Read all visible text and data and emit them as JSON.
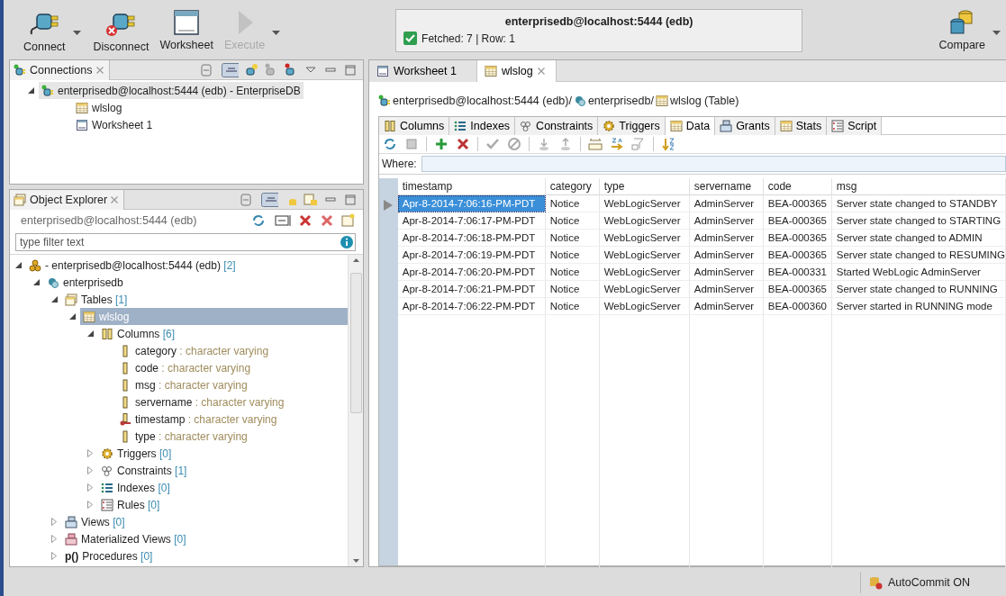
{
  "toolbar": {
    "buttons": [
      {
        "label": "Connect",
        "disabled": false,
        "dropdown": true
      },
      {
        "label": "Disconnect",
        "disabled": false,
        "dropdown": false
      },
      {
        "label": "Worksheet",
        "disabled": false,
        "dropdown": false
      },
      {
        "label": "Execute",
        "disabled": true,
        "dropdown": true
      }
    ],
    "status": {
      "title": "enterprisedb@localhost:5444 (edb)",
      "message": "Fetched: 7 | Row: 1",
      "ok": true
    },
    "compare": {
      "label": "Compare",
      "dropdown": true
    }
  },
  "connections": {
    "title": "Connections",
    "tree": [
      {
        "label": "enterprisedb@localhost:5444 (edb) - EnterpriseDB",
        "kind": "connection",
        "expanded": true,
        "selected": true,
        "children": [
          {
            "label": "wlslog",
            "kind": "table",
            "selected": false
          },
          {
            "label": "Worksheet 1",
            "kind": "worksheet",
            "selected": false
          }
        ]
      }
    ]
  },
  "object_explorer": {
    "title": "Object Explorer",
    "connection": "enterprisedb@localhost:5444 (edb)",
    "filter_placeholder": "type filter text",
    "tree": [
      {
        "label": "- enterprisedb@localhost:5444 (edb)",
        "count": "[2]",
        "kind": "server",
        "expanded": true,
        "selected": false,
        "children": [
          {
            "label": "enterprisedb",
            "kind": "schema",
            "expanded": true,
            "selected": false,
            "children": [
              {
                "label": "Tables",
                "count": "[1]",
                "kind": "tables",
                "expanded": true,
                "selected": false,
                "children": [
                  {
                    "label": "wlslog",
                    "kind": "table",
                    "expanded": true,
                    "selected": true,
                    "children": [
                      {
                        "label": "Columns",
                        "count": "[6]",
                        "kind": "columns",
                        "expanded": true,
                        "selected": false,
                        "children": [
                          {
                            "label": "category",
                            "type": " : character varying",
                            "kind": "column",
                            "selected": false
                          },
                          {
                            "label": "code",
                            "type": " : character varying",
                            "kind": "column",
                            "selected": false
                          },
                          {
                            "label": "msg",
                            "type": " : character varying",
                            "kind": "column",
                            "selected": false
                          },
                          {
                            "label": "servername",
                            "type": " : character varying",
                            "kind": "column",
                            "selected": false
                          },
                          {
                            "label": "timestamp",
                            "type": " : character varying",
                            "kind": "key",
                            "selected": false
                          },
                          {
                            "label": "type",
                            "type": " : character varying",
                            "kind": "column",
                            "selected": false
                          }
                        ]
                      },
                      {
                        "label": "Triggers",
                        "count": "[0]",
                        "kind": "triggers",
                        "expanded": false,
                        "selected": false
                      },
                      {
                        "label": "Constraints",
                        "count": "[1]",
                        "kind": "constraints",
                        "expanded": false,
                        "selected": false
                      },
                      {
                        "label": "Indexes",
                        "count": "[0]",
                        "kind": "indexes",
                        "expanded": false,
                        "selected": false
                      },
                      {
                        "label": "Rules",
                        "count": "[0]",
                        "kind": "rules",
                        "expanded": false,
                        "selected": false
                      }
                    ]
                  }
                ]
              },
              {
                "label": "Views",
                "count": "[0]",
                "kind": "views",
                "expanded": false,
                "selected": false
              },
              {
                "label": "Materialized Views",
                "count": "[0]",
                "kind": "matviews",
                "expanded": false,
                "selected": false
              },
              {
                "label": "Procedures",
                "icon_text": "p()",
                "count": "[0]",
                "kind": "procedures",
                "expanded": false,
                "selected": false
              }
            ]
          }
        ]
      }
    ]
  },
  "editor": {
    "tabs": [
      {
        "label": "Worksheet 1",
        "kind": "worksheet",
        "selected": false,
        "closable": false
      },
      {
        "label": "wlslog",
        "kind": "table",
        "selected": true,
        "closable": true
      }
    ],
    "breadcrumb": [
      {
        "label": "enterprisedb@localhost:5444 (edb)/",
        "kind": "connection"
      },
      {
        "label": "enterprisedb/",
        "kind": "schema"
      },
      {
        "label": "wlslog (Table)",
        "kind": "table"
      }
    ],
    "subtabs": [
      {
        "label": "Columns",
        "selected": false
      },
      {
        "label": "Indexes",
        "selected": false
      },
      {
        "label": "Constraints",
        "selected": false
      },
      {
        "label": "Triggers",
        "selected": false
      },
      {
        "label": "Data",
        "selected": true
      },
      {
        "label": "Grants",
        "selected": false
      },
      {
        "label": "Stats",
        "selected": false
      },
      {
        "label": "Script",
        "selected": false
      }
    ],
    "where_label": "Where:",
    "table": {
      "columns": [
        "timestamp",
        "category",
        "type",
        "servername",
        "code",
        "msg"
      ],
      "rows": [
        {
          "selected": true,
          "cells": [
            "Apr-8-2014-7:06:16-PM-PDT",
            "Notice",
            "WebLogicServer",
            "AdminServer",
            "BEA-000365",
            "Server state changed to STANDBY"
          ]
        },
        {
          "selected": false,
          "cells": [
            "Apr-8-2014-7:06:17-PM-PDT",
            "Notice",
            "WebLogicServer",
            "AdminServer",
            "BEA-000365",
            "Server state changed to STARTING"
          ]
        },
        {
          "selected": false,
          "cells": [
            "Apr-8-2014-7:06:18-PM-PDT",
            "Notice",
            "WebLogicServer",
            "AdminServer",
            "BEA-000365",
            "Server state changed to ADMIN"
          ]
        },
        {
          "selected": false,
          "cells": [
            "Apr-8-2014-7:06:19-PM-PDT",
            "Notice",
            "WebLogicServer",
            "AdminServer",
            "BEA-000365",
            "Server state changed to RESUMING"
          ]
        },
        {
          "selected": false,
          "cells": [
            "Apr-8-2014-7:06:20-PM-PDT",
            "Notice",
            "WebLogicServer",
            "AdminServer",
            "BEA-000331",
            "Started WebLogic AdminServer"
          ]
        },
        {
          "selected": false,
          "cells": [
            "Apr-8-2014-7:06:21-PM-PDT",
            "Notice",
            "WebLogicServer",
            "AdminServer",
            "BEA-000365",
            "Server state changed to RUNNING"
          ]
        },
        {
          "selected": false,
          "cells": [
            "Apr-8-2014-7:06:22-PM-PDT",
            "Notice",
            "WebLogicServer",
            "AdminServer",
            "BEA-000360",
            "Server started in RUNNING mode"
          ]
        }
      ]
    }
  },
  "status_bar": {
    "autocommit": "AutoCommit ON"
  }
}
